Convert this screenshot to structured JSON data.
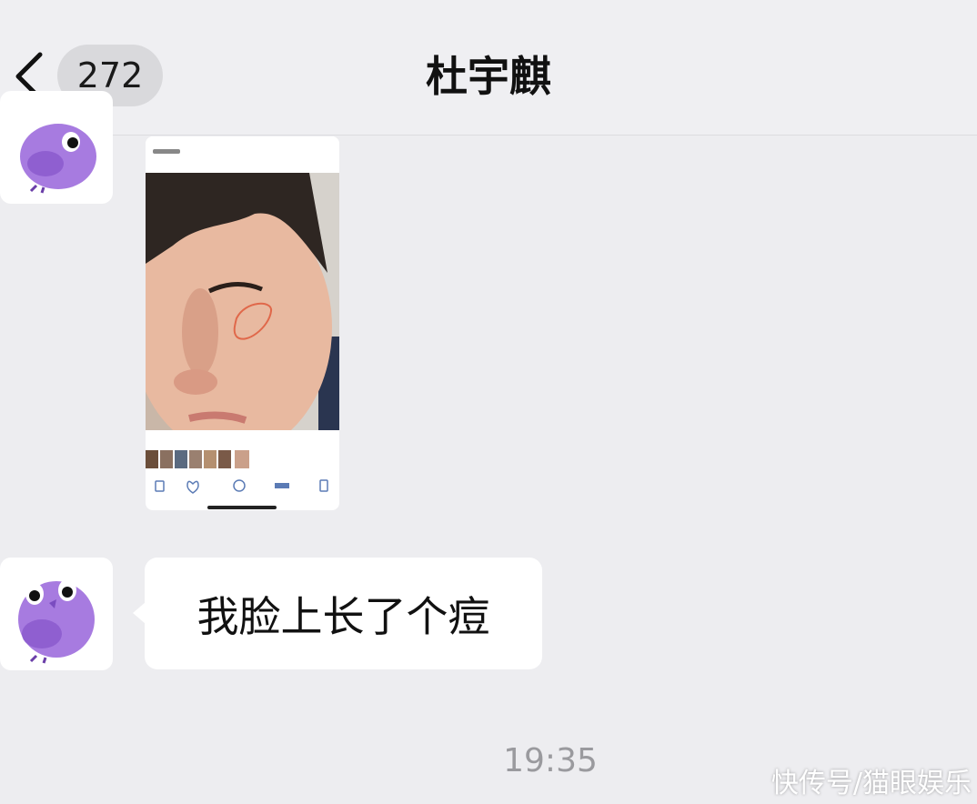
{
  "header": {
    "back_icon": "chevron-left-icon",
    "unread_count": "272",
    "title": "杜宇麒"
  },
  "messages": [
    {
      "type": "image",
      "sender": "contact",
      "avatar_icon": "purple-bird-sticker-avatar"
    },
    {
      "type": "text",
      "sender": "contact",
      "avatar_icon": "purple-bird-sticker-avatar",
      "text": "我脸上长了个痘"
    }
  ],
  "timestamp": "19:35",
  "watermark": "快传号/猫眼娱乐",
  "colors": {
    "background": "#ededf0",
    "bubble": "#ffffff",
    "avatar_bird": "#a77be0",
    "annotation_circle": "#e0684a"
  }
}
